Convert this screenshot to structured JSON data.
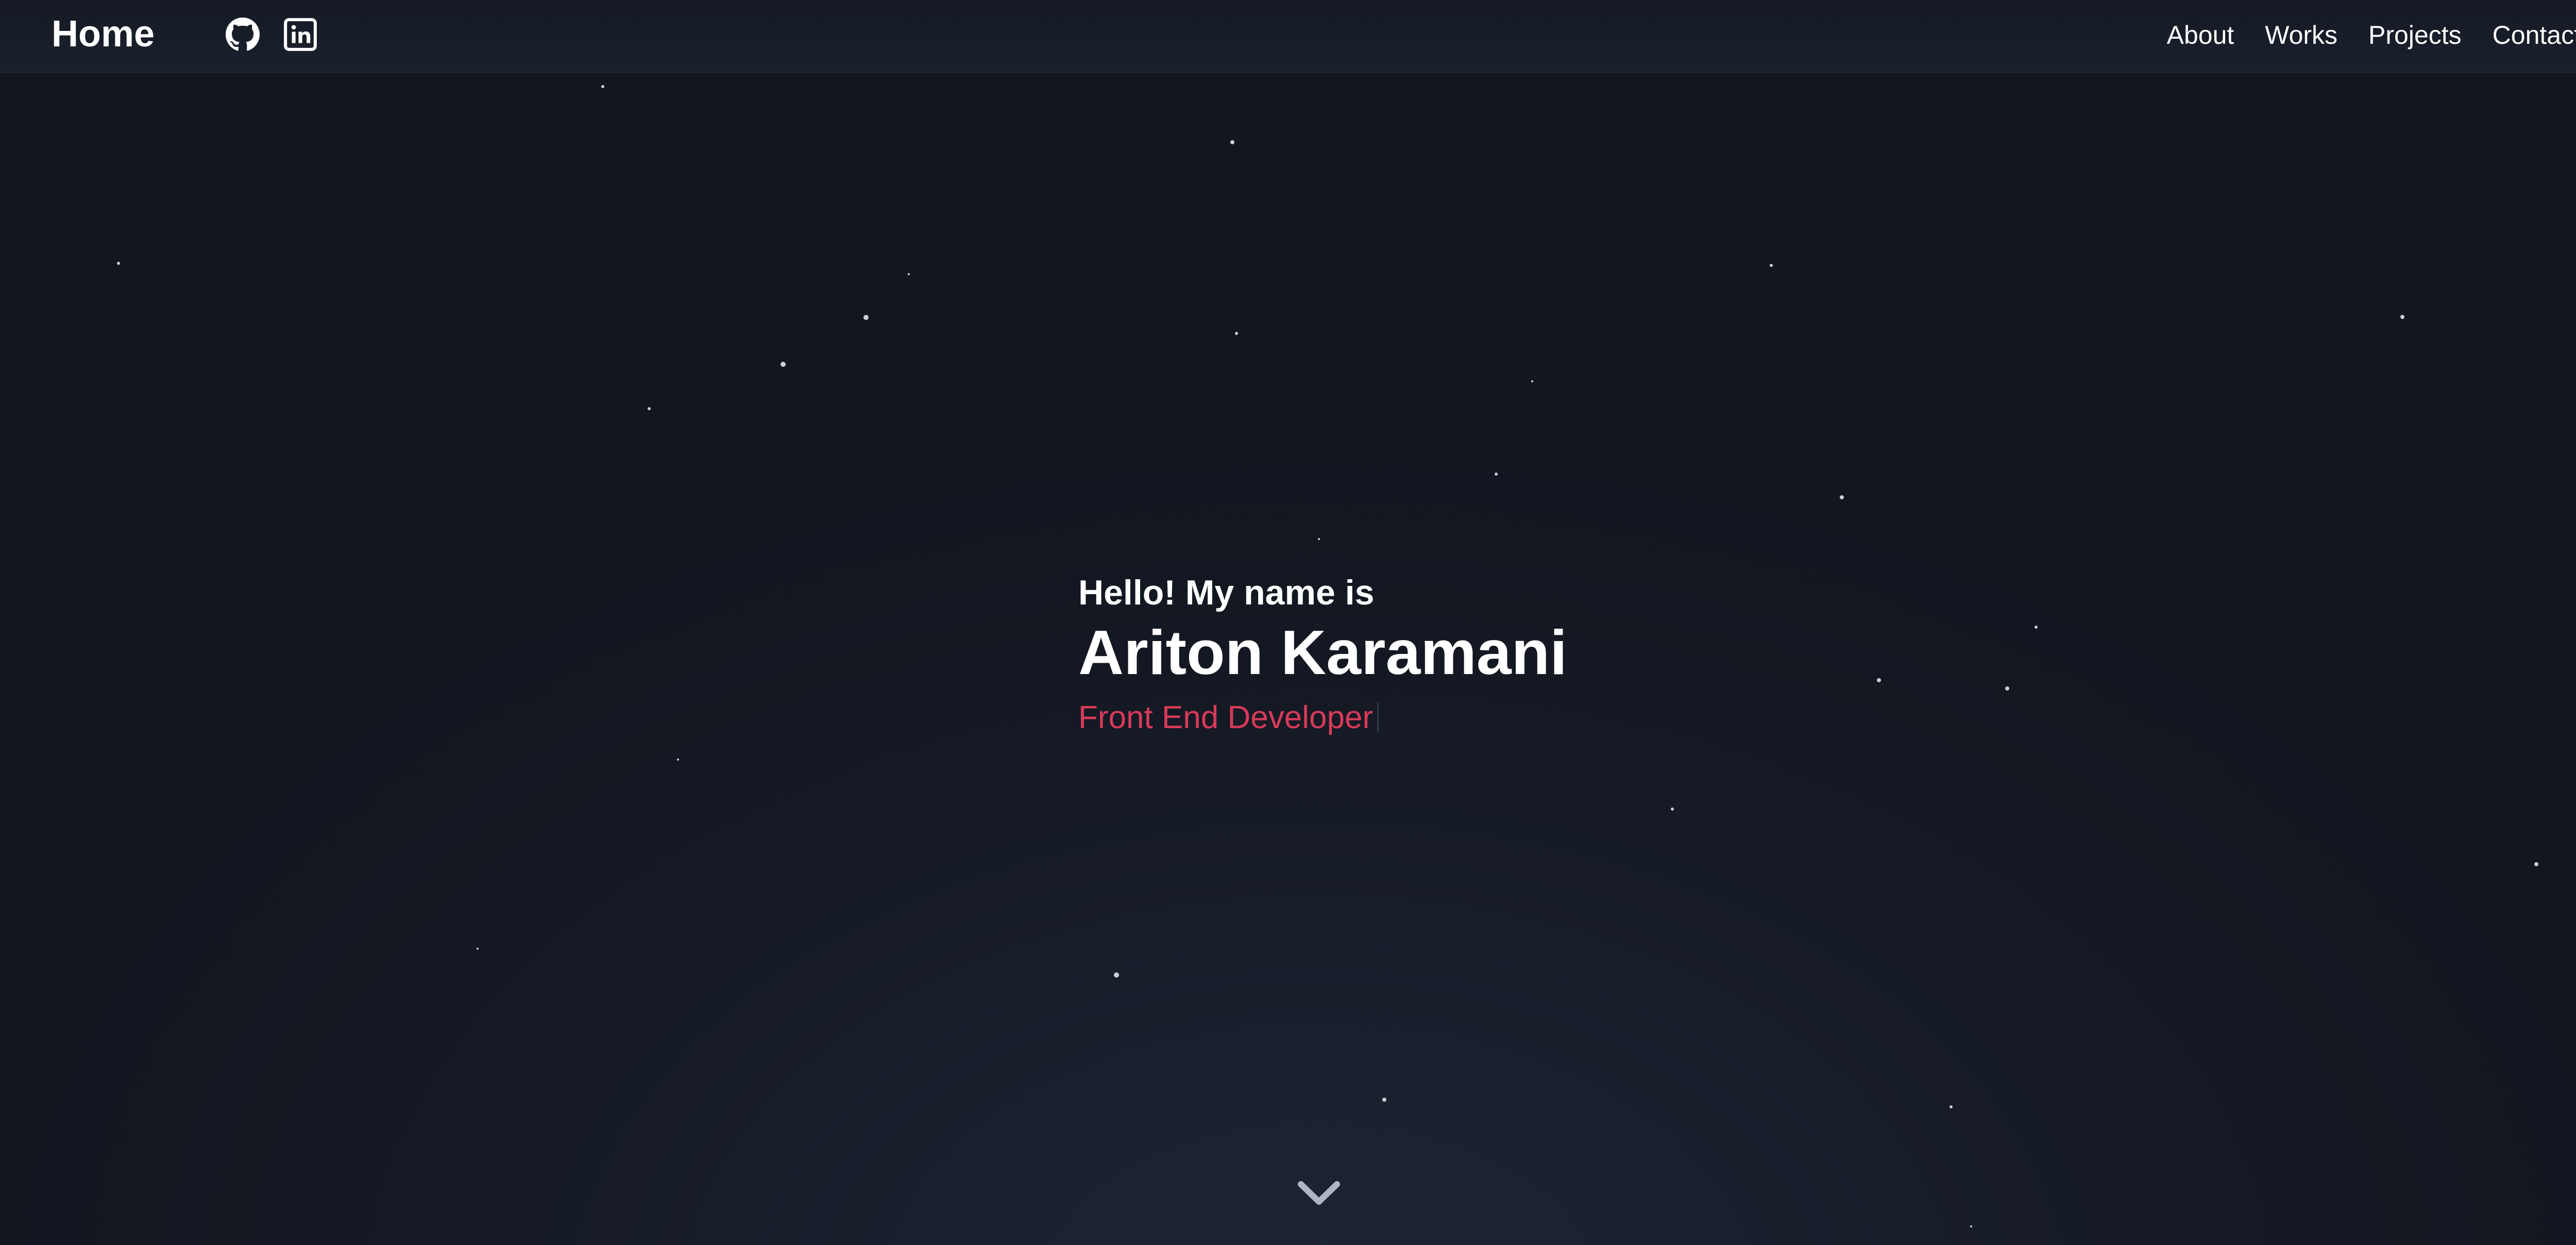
{
  "nav": {
    "brand": "Home",
    "links": [
      "About",
      "Works",
      "Projects",
      "Contact"
    ]
  },
  "social": {
    "github_icon": "github-icon",
    "linkedin_icon": "linkedin-icon"
  },
  "hero": {
    "greeting": "Hello! My name is",
    "name": "Ariton Karamani",
    "role": "Front End Developer"
  },
  "scroll": {
    "icon": "chevron-down-icon"
  },
  "colors": {
    "background": "#151a24",
    "accent": "#d83a5a",
    "text": "#ffffff"
  }
}
